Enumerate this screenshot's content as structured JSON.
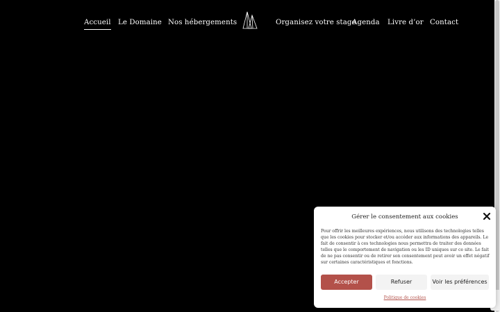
{
  "nav": {
    "items": [
      {
        "label": "Accueil",
        "active": true
      },
      {
        "label": "Le Domaine"
      },
      {
        "label": "Nos hébergements"
      },
      {
        "label": "Organisez votre stage"
      },
      {
        "label": "Agenda"
      },
      {
        "label": "Livre d’or"
      },
      {
        "label": "Contact"
      }
    ],
    "logo_icon": "triangles-logo-icon"
  },
  "cookie": {
    "title": "Gérer le consentement aux cookies",
    "text": "Pour offrir les meilleures expériences, nous utilisons des technologies telles que les cookies pour stocker et/ou accéder aux informations des appareils. Le fait de consentir à ces technologies nous permettra de traiter des données telles que le comportement de navigation ou les ID uniques sur ce site. Le fait de ne pas consentir ou de retirer son consentement peut avoir un effet négatif sur certaines caractéristiques et fonctions.",
    "accept_label": "Accepter",
    "refuse_label": "Refuser",
    "prefs_label": "Voir les préférences",
    "policy_label": "Politique de cookies",
    "accent_color": "#b3514a"
  }
}
